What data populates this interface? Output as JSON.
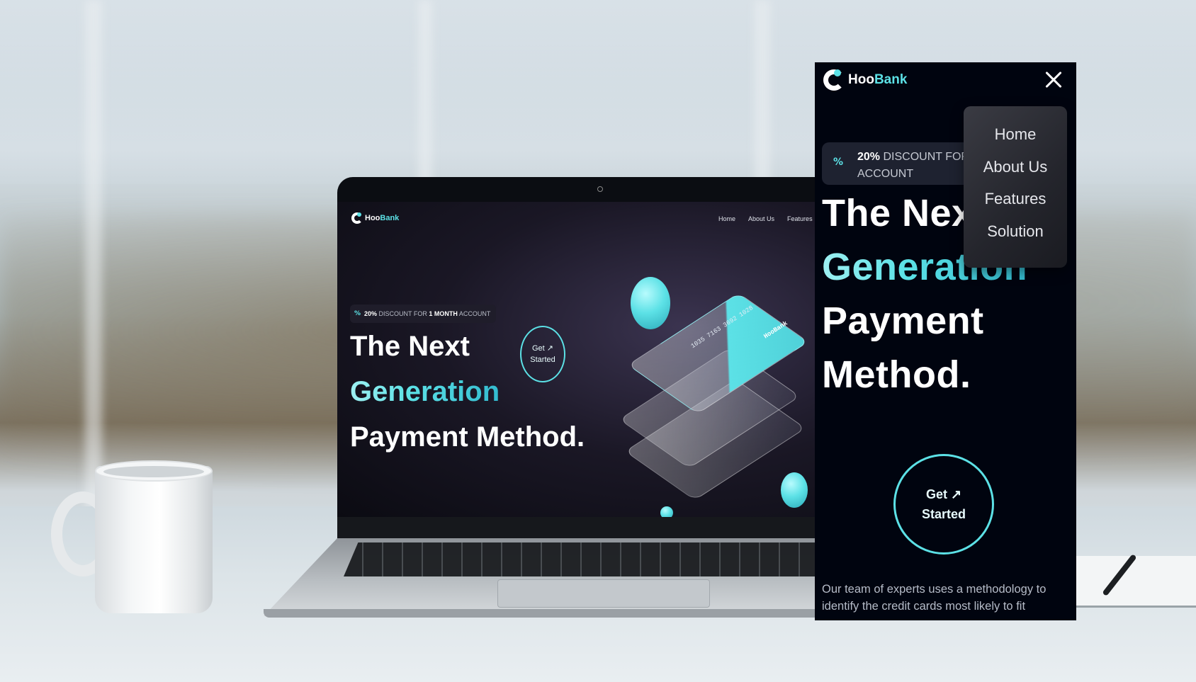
{
  "brand": {
    "name_part1": "Hoo",
    "name_part2": "Bank",
    "accent": "#5ce1e6",
    "background": "#00040f"
  },
  "laptop": {
    "nav": [
      "Home",
      "About Us",
      "Features"
    ],
    "badge": {
      "icon": "percent-icon",
      "bold": "20%",
      "middle": " DISCOUNT FOR ",
      "bold2": "1 MONTH",
      "rest": " ACCOUNT"
    },
    "headline": {
      "line1": "The Next",
      "line2": "Generation",
      "line3": "Payment Method."
    },
    "cta": {
      "line1": "Get ↗",
      "line2": "Started"
    },
    "card_number": "1035 7163 3692 1028",
    "card_brand": "HooBank"
  },
  "mobile": {
    "close_icon": "close-icon",
    "menu": [
      "Home",
      "About Us",
      "Features",
      "Solution"
    ],
    "badge": {
      "bold": "20%",
      "line1_rest": " DISCOUNT FOR 1",
      "line2": "ACCOUNT"
    },
    "headline": {
      "line1": "The Nex",
      "line2": "Generation",
      "line3": "Payment",
      "line4": "Method."
    },
    "cta": {
      "line1": "Get ↗",
      "line2": "Started"
    },
    "paragraph": "Our team of experts uses a methodology to identify the credit cards most likely to fit"
  }
}
